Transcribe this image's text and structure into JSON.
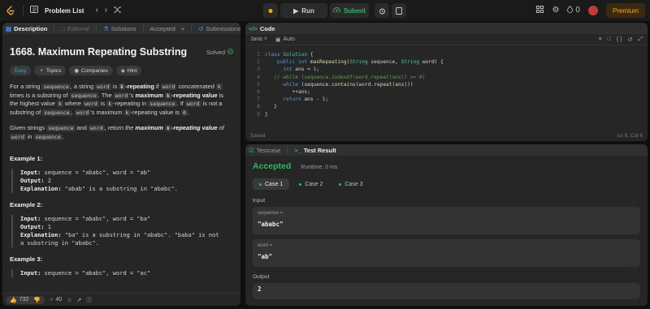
{
  "topbar": {
    "problem_list": "Problem List",
    "run_label": "Run",
    "submit_label": "Submit",
    "streak": "0",
    "premium": "Premium"
  },
  "left_tabs": [
    {
      "label": "Description"
    },
    {
      "label": "Editorial"
    },
    {
      "label": "Solutions"
    },
    {
      "label": "Accepted"
    },
    {
      "label": "Submissions"
    }
  ],
  "problem": {
    "title": "1668. Maximum Repeating Substring",
    "status": "Solved",
    "pills": [
      "Easy",
      "Topics",
      "Companies",
      "Hint"
    ],
    "examples": [
      {
        "title": "Example 1:",
        "input_label": "Input:",
        "input": "sequence = \"ababc\", word = \"ab\"",
        "output_label": "Output:",
        "output": "2",
        "explanation_label": "Explanation:",
        "explanation": "\"abab\" is a substring in \"ababc\"."
      },
      {
        "title": "Example 2:",
        "input_label": "Input:",
        "input": "sequence = \"ababc\", word = \"ba\"",
        "output_label": "Output:",
        "output": "1",
        "explanation_label": "Explanation:",
        "explanation": "\"ba\" is a substring in \"ababc\". \"baba\" is not",
        "explanation_2": "a substring in \"ababc\"."
      },
      {
        "title": "Example 3:",
        "input_label": "Input:",
        "input": "sequence = \"ababc\", word = \"ac\""
      }
    ]
  },
  "footer": {
    "likes": "732",
    "comments": "40"
  },
  "code": {
    "tab": "Code",
    "language": "Java",
    "mode": "Auto",
    "saved": "Saved",
    "cursor": "Ln 8, Col 6",
    "line_numbers": [
      "1",
      "2",
      "3",
      "4",
      "5",
      "6",
      "7",
      "8",
      "9"
    ]
  },
  "test": {
    "tab_testcase": "Testcase",
    "tab_result": "Test Result",
    "verdict": "Accepted",
    "runtime": "Runtime: 0 ms",
    "cases": [
      "Case 1",
      "Case 2",
      "Case 3"
    ],
    "input_label": "Input",
    "inputs": [
      {
        "name": "sequence =",
        "value": "\"ababc\""
      },
      {
        "name": "word =",
        "value": "\"ab\""
      }
    ],
    "output_label": "Output",
    "output_value": "2"
  },
  "colors": {
    "accent": "#ffa116",
    "success": "#2cbb5d",
    "easy": "#1cbaba"
  }
}
